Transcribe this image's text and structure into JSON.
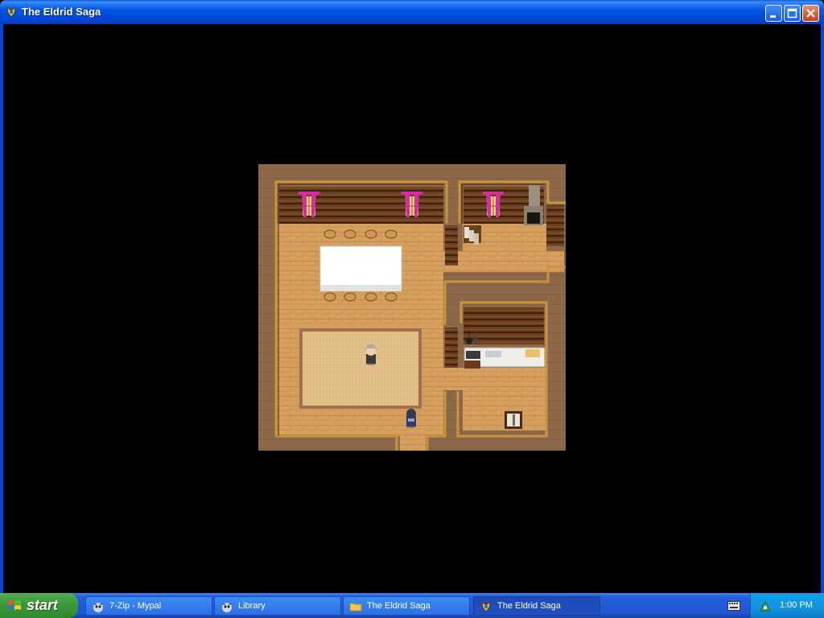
{
  "window": {
    "title": "The Eldrid Saga",
    "icon": "game-icon",
    "controls": {
      "minimize": "minimize-icon",
      "maximize": "maximize-icon",
      "close": "close-icon"
    }
  },
  "scene": {
    "type": "top-down RPG interior map",
    "characters": [
      "npc-gray-haired-character",
      "player-character"
    ]
  },
  "taskbar": {
    "start_label": "start",
    "tasks": [
      {
        "label": "7-Zip - Mypal",
        "icon": "browser-icon",
        "active": false
      },
      {
        "label": "Library",
        "icon": "browser-icon",
        "active": false
      },
      {
        "label": "The Eldrid Saga",
        "icon": "folder-icon",
        "active": false
      },
      {
        "label": "The Eldrid Saga",
        "icon": "game-icon",
        "active": true
      }
    ],
    "clock": "1:00 PM"
  },
  "colors": {
    "titlebar_blue": "#0054e3",
    "start_green": "#3c9a3c",
    "floor_wood": "#d8a360",
    "wall_log": "#5a3418"
  }
}
